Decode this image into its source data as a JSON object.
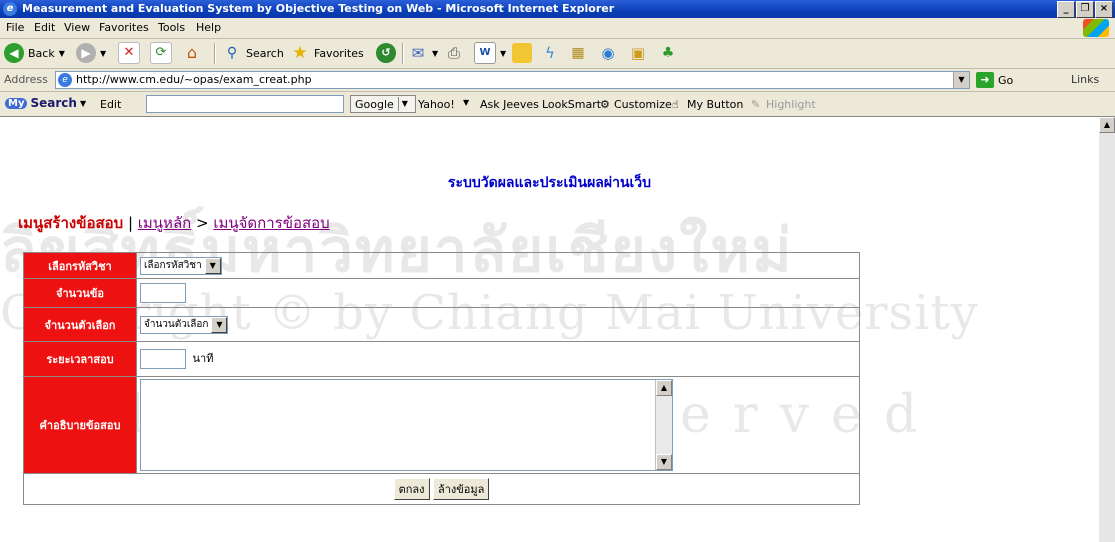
{
  "window": {
    "title": "Measurement and Evaluation System by Objective Testing on Web - Microsoft Internet Explorer",
    "minimize": "_",
    "maximize": "❐",
    "close": "×"
  },
  "menu": [
    "File",
    "Edit",
    "View",
    "Favorites",
    "Tools",
    "Help"
  ],
  "toolbar": {
    "back_label": "Back",
    "search_label": "Search",
    "favorites_label": "Favorites"
  },
  "address": {
    "label": "Address",
    "url": "http://www.cm.edu/~opas/exam_creat.php",
    "go_label": "Go",
    "links_label": "Links"
  },
  "searchbar": {
    "brand": "Search",
    "brand_badge": "My",
    "edit_label": "Edit",
    "google_label": "Google",
    "items": [
      "Yahoo!",
      "Ask Jeeves",
      "LookSmart",
      "Customize",
      "My Button",
      "Highlight"
    ]
  },
  "page": {
    "heading": "ระบบวัดผลและประเมินผลผ่านเว็บ",
    "breadcrumb_current": "เมนูสร้างข้อสอบ",
    "breadcrumb_sep1": " | ",
    "breadcrumb_home": "เมนูหลัก",
    "breadcrumb_sep2": " > ",
    "breadcrumb_manage": "เมนูจัดการข้อสอบ",
    "watermark_line1": "ลิขสิทธิ์มหาวิทยาลัยเชียงใหม่",
    "watermark_line2": "Copyright © by Chiang Mai University",
    "watermark_line3": "All rights reserved"
  },
  "form": {
    "subject_label": "เลือกรหัสวิชา",
    "subject_value": "เลือกรหัสวิชา",
    "count_label": "จำนวนข้อ",
    "choices_label": "จำนวนตัวเลือก",
    "choices_value": "จำนวนตัวเลือก",
    "duration_label": "ระยะเวลาสอบ",
    "duration_unit": "นาที",
    "description_label": "คำอธิบายข้อสอบ",
    "submit_label": "ตกลง",
    "reset_label": "ล้างข้อมูล"
  }
}
